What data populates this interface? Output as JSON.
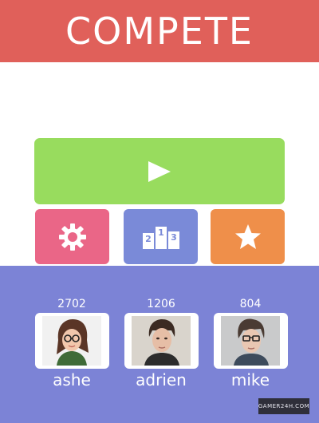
{
  "header": {
    "title": "COMPETE"
  },
  "actions": {
    "play_icon": "play-icon",
    "settings_icon": "gear-icon",
    "leaderboard_icon": "podium-icon",
    "favorite_icon": "star-icon",
    "podium_places": [
      "2",
      "1",
      "3"
    ]
  },
  "players": [
    {
      "score": "2702",
      "name": "ashe"
    },
    {
      "score": "1206",
      "name": "adrien"
    },
    {
      "score": "804",
      "name": "mike"
    }
  ],
  "watermark": "GAMER24H.COM",
  "colors": {
    "header": "#e0605a",
    "play": "#98dc5e",
    "settings": "#ea6687",
    "leaderboard": "#7a8ad8",
    "favorite": "#ef8f4a",
    "panel": "#7c83d6"
  }
}
